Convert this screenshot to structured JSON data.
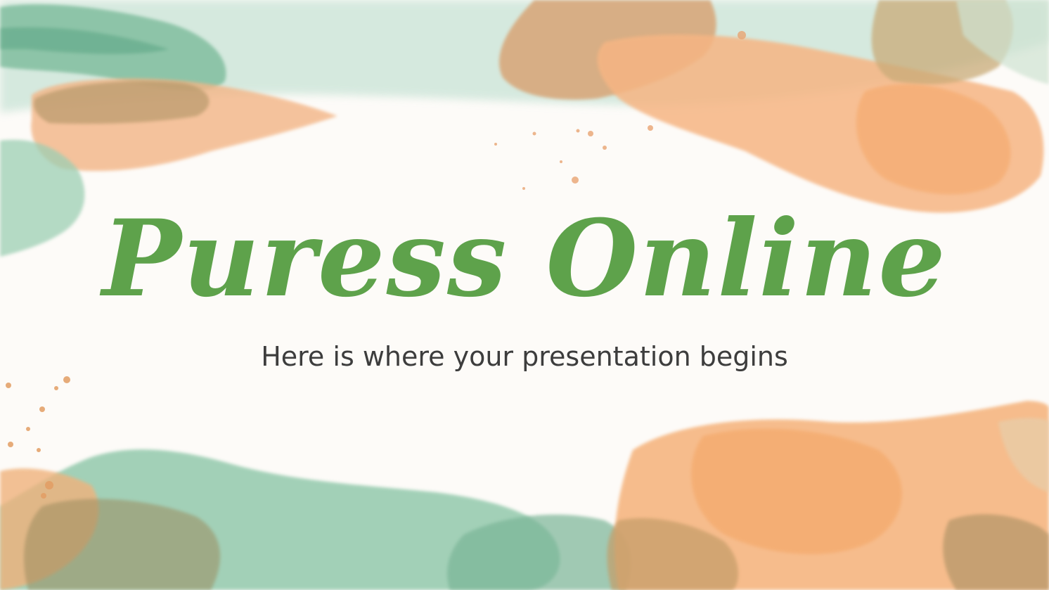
{
  "slide": {
    "title": "Puress Online",
    "subtitle": "Here is where your presentation begins"
  },
  "colors": {
    "title": "#5ea24b",
    "subtitle": "#3d3d3d",
    "green_wash": "#8fc7a8",
    "orange_wash": "#f6b27a",
    "brown_wash": "#c8a06a",
    "paper": "#fdfbf8"
  },
  "decorations": {
    "style": "watercolor brush strokes",
    "top_left": "green and orange watercolor blobs",
    "top_right": "orange and tan watercolor blobs",
    "bottom_left": "green and orange watercolor blobs",
    "bottom_right": "orange and tan watercolor blobs"
  }
}
